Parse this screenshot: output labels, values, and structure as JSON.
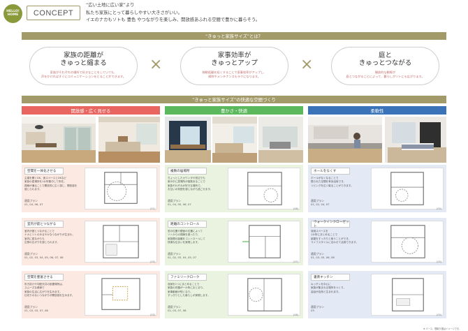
{
  "logo": {
    "line1": "HELLO!",
    "line2": "HOME"
  },
  "header": {
    "concept_label": "CONCEPT",
    "tagline_1": "“広い土地に広い家”より",
    "tagline_2": "私たち家族にとって暮らしやすい大きさがいい。",
    "tagline_3": "イエのナカもソトも 豊色 やつながりを楽しみ、開放感あふれる空間で豊かに暮らそう。"
  },
  "section1_title": "“きゅっと家族サイズ”とは？",
  "concepts": [
    {
      "title_1": "家族の距離が",
      "title_2": "きゅっと縮まる",
      "sub_1": "家族がそれぞれの場所で好きなことをしていても、",
      "sub_2": "声をかければすぐにコミュニケーションをとることができます。"
    },
    {
      "title_1": "家事効率が",
      "title_2": "きゅっとアップ",
      "sub_1": "移動距離を短くすることで家事効率がアップし、",
      "sub_2": "掃除やメンテナンスもラクになります。"
    },
    {
      "title_1": "庭と",
      "title_2": "きゅっとつながる",
      "sub_1": "開放的な動線が",
      "sub_2": "庭とつながることによって、暮らしがソトにも広がります。"
    }
  ],
  "times_symbol": "×",
  "section2_title": "“きゅっと家族サイズ”の快適な空間づくり",
  "columns": [
    {
      "heading": "開放感・広く見せる",
      "color": "#e8665f",
      "card_bg": "#fbe9e2",
      "cards": [
        {
          "label": "空間を一体化させる",
          "desc_1": "主寝を開くDK、食スペースとDKなど",
          "desc_2": "家族の居場所を1か所集中して所在。",
          "desc_3": "視線が通ることで開放的に広く感じ、開放感を",
          "desc_4": "感じられます。",
          "plan_label": "適用プラン",
          "plan_nums": "01, 04, 06, 07",
          "ref": "(01)"
        },
        {
          "label": "室内が庭とつながる",
          "desc_1": "室内が庭とつながることで",
          "desc_2": "ナカとソトのゆるやかなつながりが生まれ、",
          "desc_3": "室内に居ながらも",
          "desc_4": "広際の広がりを感じられます。",
          "plan_label": "適用プラン",
          "plan_nums": "01, 02, 03, 04, 05, 06, 07, 08",
          "ref": "(03)"
        },
        {
          "label": "空間を豊富させる",
          "desc_1": "吹き抜けや勾配天井の設置場所は、",
          "desc_2": "スムーズな導線で",
          "desc_3": "家族の生活に広がりを生みます。",
          "desc_4": "仕切りのないつながりが開放感を生みます。",
          "plan_label": "適用プラン",
          "plan_nums": "01, 03, 03, 07, 08",
          "ref": "(03)"
        }
      ]
    },
    {
      "heading": "豊かさ・快適",
      "color": "#5cb85c",
      "card_bg": "#e9f3e0",
      "cards": [
        {
          "label": "複数の居場所",
          "desc_1": "ちょっとしたカウンタや窓辺でも",
          "desc_2": "家の中に居場所が複数あることで",
          "desc_3": "家族それぞれが好きな場所で、",
          "desc_4": "お互いの気配を感じながら過ごせます。",
          "plan_label": "適用プラン",
          "plan_nums": "01, 04, 05, 06, 07",
          "ref": "(08)"
        },
        {
          "label": "距離のコントロール",
          "desc_1": "窓の位置や壁面の位置によって",
          "desc_2": "ソトからの視線を遮ったり、",
          "desc_3": "家族間の距離をコントロールして",
          "desc_4": "快適な住まいを実現します。",
          "plan_label": "適用プラン",
          "plan_nums": "01, 02, 03, 04, 05, 07",
          "ref": "(07)"
        },
        {
          "label": "ファミリークローク",
          "desc_1": "収納を1つにまとめることで",
          "desc_2": "家族の衣類が一か所にまとまり、",
          "desc_3": "家事動線が短くなり、",
          "desc_4": "すっきりとした暮らしが実現します。",
          "plan_label": "適用プラン",
          "plan_nums": "02, 03, 07, 08",
          "ref": "(08)"
        }
      ]
    },
    {
      "heading": "柔軟性",
      "color": "#3a73b8",
      "card_bg": "#e3eaf5",
      "cards": [
        {
          "label": "ホールをなくす",
          "desc_1": "ホールがなくなることで",
          "desc_2": "限られた空間を有効活用でき、",
          "desc_3": "リビングを広く取ることができます。",
          "desc_4": "",
          "plan_label": "適用プラン",
          "plan_nums": "01, 02, 04, 07",
          "ref": "(03)"
        },
        {
          "label": "ウォークインクローゼット",
          "desc_1": "収納スペースを",
          "desc_2": "1か所にまとめることで",
          "desc_3": "部屋をすっきりと使うことができ、",
          "desc_4": "ライフスタイルに合わせて活用できます。",
          "plan_label": "適用プラン",
          "plan_nums": "01, 03, 05, 06, 08",
          "ref": "(03)"
        },
        {
          "label": "書斎キッチン",
          "desc_1": "キッチンを中心に",
          "desc_2": "家族が集まれる場所をつくり、",
          "desc_3": "会話が自然と生まれます。",
          "desc_4": "",
          "plan_label": "適用プラン",
          "plan_nums": "03",
          "ref": "(03)"
        }
      ]
    }
  ],
  "footer_note": "※ パース、間取り図はイメージです。"
}
